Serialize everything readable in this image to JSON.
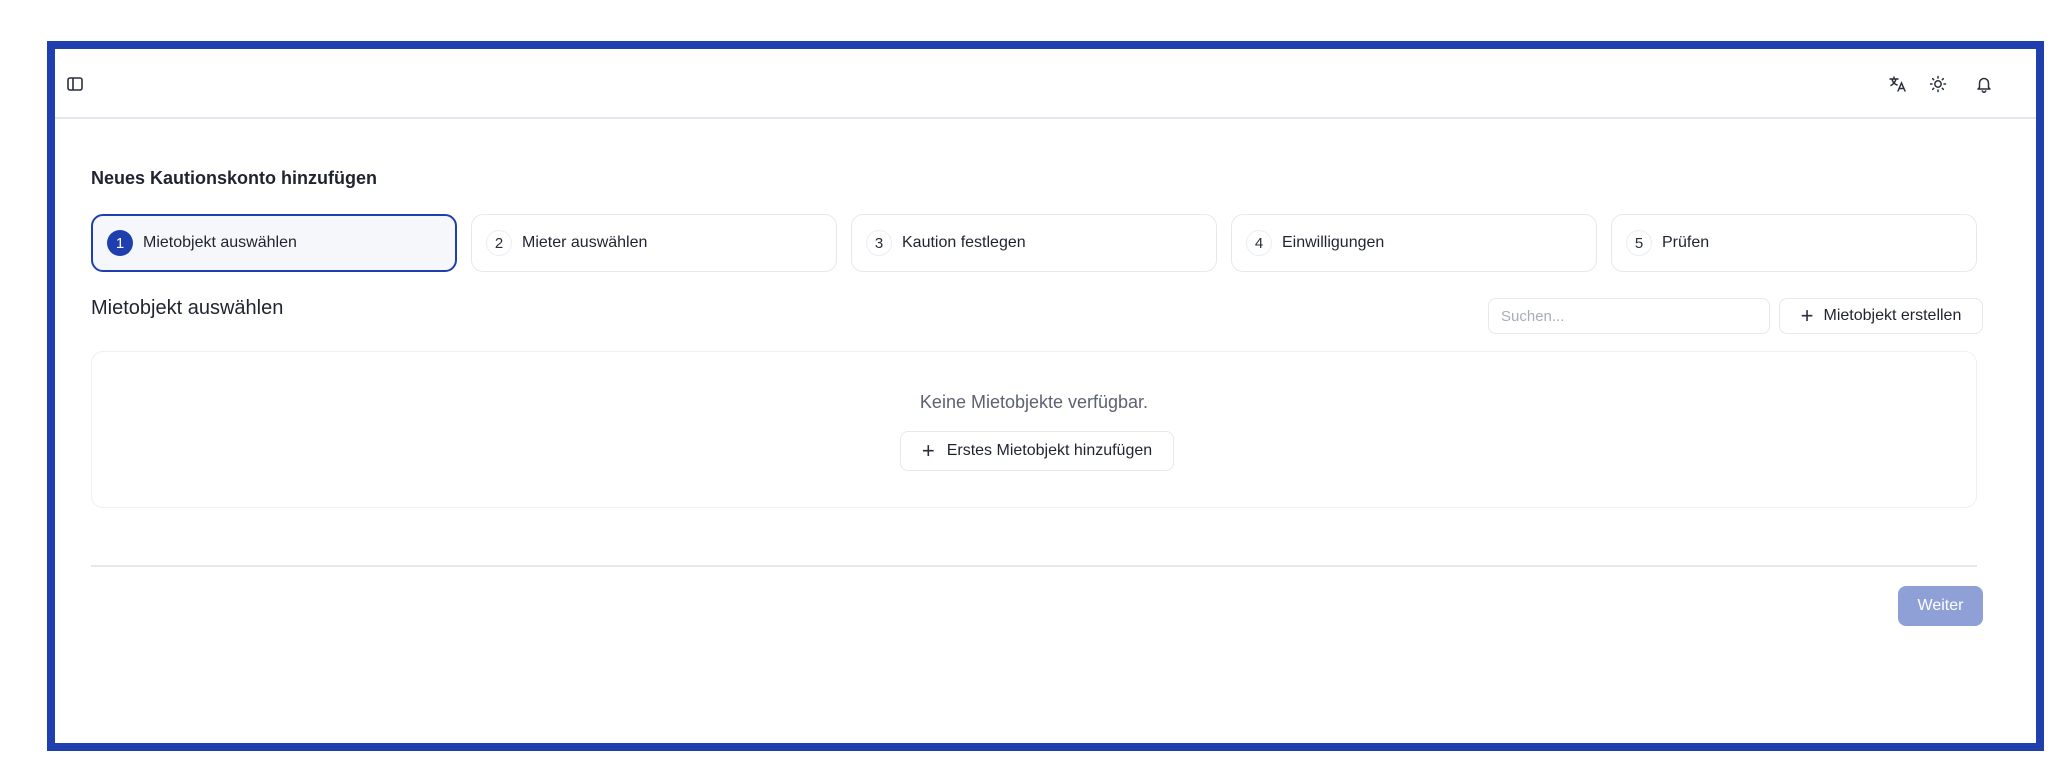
{
  "topbar": {
    "icons": [
      "sidebar-toggle-icon",
      "translate-icon",
      "sun-icon",
      "bell-icon"
    ]
  },
  "page": {
    "title": "Neues Kautionskonto hinzufügen"
  },
  "steps": [
    {
      "number": "1",
      "label": "Mietobjekt auswählen",
      "active": true
    },
    {
      "number": "2",
      "label": "Mieter auswählen",
      "active": false
    },
    {
      "number": "3",
      "label": "Kaution festlegen",
      "active": false
    },
    {
      "number": "4",
      "label": "Einwilligungen",
      "active": false
    },
    {
      "number": "5",
      "label": "Prüfen",
      "active": false
    }
  ],
  "section": {
    "title": "Mietobjekt auswählen",
    "search_placeholder": "Suchen...",
    "create_button": "Mietobjekt erstellen",
    "plus": "+"
  },
  "empty_state": {
    "message": "Keine Mietobjekte verfügbar.",
    "add_button": "Erstes Mietobjekt hinzufügen",
    "plus": "+"
  },
  "footer": {
    "next_button": "Weiter"
  },
  "colors": {
    "accent": "#1f3fae",
    "next_button_bg": "#8fa0d6"
  }
}
